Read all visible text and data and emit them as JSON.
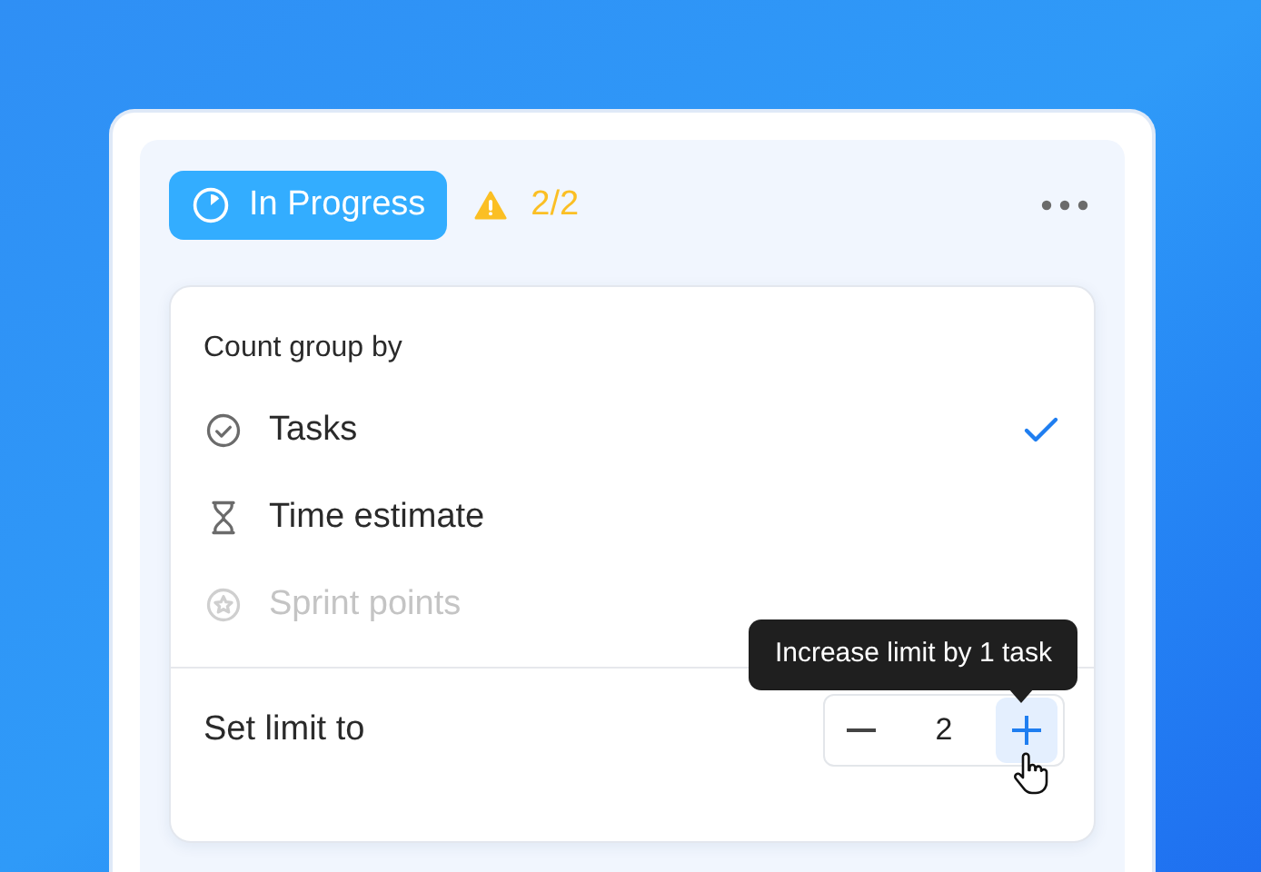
{
  "status": {
    "label": "In Progress",
    "warning": true,
    "count": "2/2"
  },
  "menu": {
    "heading": "Count group by",
    "options": [
      {
        "kind": "check",
        "label": "Tasks",
        "selected": true,
        "disabled": false
      },
      {
        "kind": "hourglass",
        "label": "Time estimate",
        "selected": false,
        "disabled": false
      },
      {
        "kind": "star",
        "label": "Sprint points",
        "selected": false,
        "disabled": true
      }
    ],
    "limit": {
      "label": "Set limit to",
      "value": "2",
      "tooltip": "Increase limit by 1 task"
    }
  }
}
